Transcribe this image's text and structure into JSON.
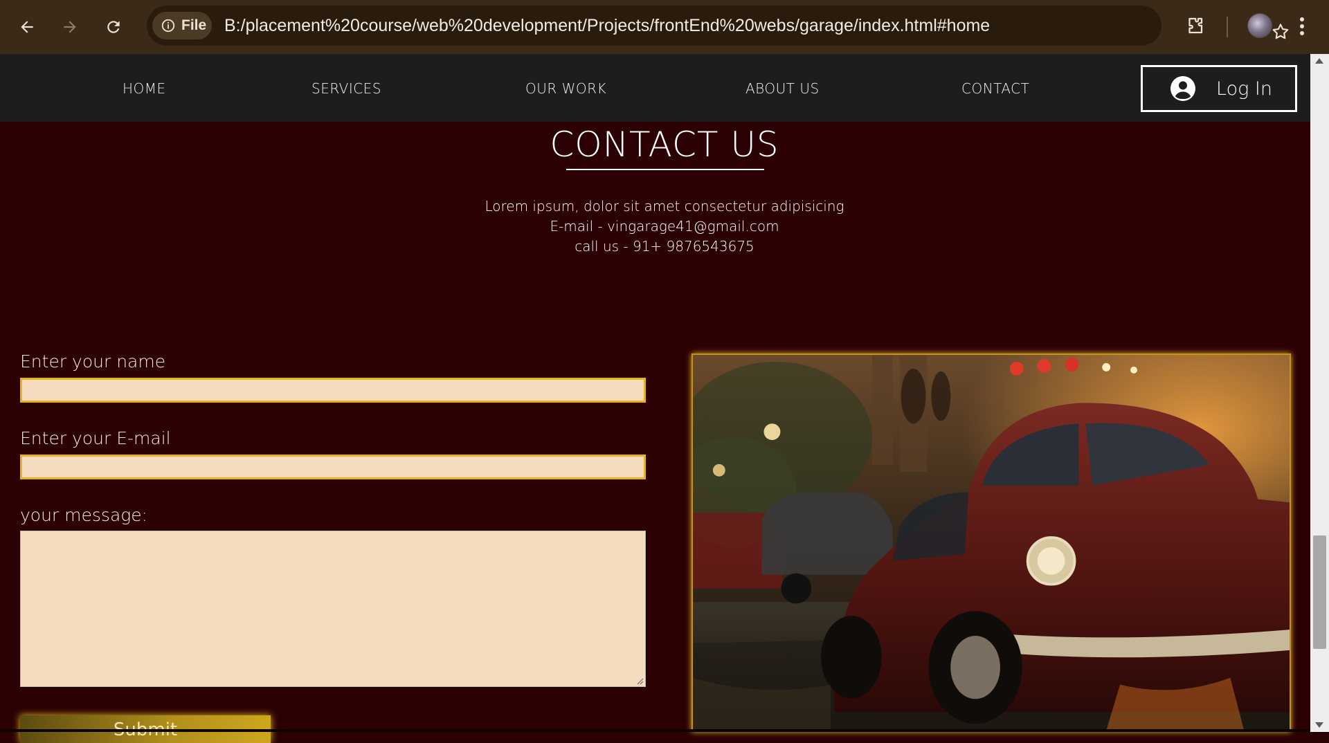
{
  "browser": {
    "file_chip": "File",
    "url": "B:/placement%20course/web%20development/Projects/frontEnd%20webs/garage/index.html#home"
  },
  "nav": {
    "links": [
      "HOME",
      "SERVICES",
      "OUR WORK",
      "ABOUT US",
      "CONTACT"
    ],
    "login_label": "Log In"
  },
  "contact": {
    "title": "CONTACT US",
    "line1": "Lorem ipsum, dolor sit amet consectetur adipisicing",
    "line2": "E-mail - vingarage41@gmail.com",
    "line3": "call us - 91+ 9876543675"
  },
  "form": {
    "name_label": "Enter your name",
    "email_label": "Enter your E-mail",
    "message_label": "your message:",
    "submit_label": "Submit"
  },
  "colors": {
    "page_bg": "#2c0104",
    "nav_bg": "#1d1d1d",
    "input_bg": "#f6dcbf",
    "input_border": "#e6b41e",
    "accent_gold": "#c49418"
  },
  "icons": {
    "back": "arrow-left-icon",
    "forward": "arrow-right-icon",
    "reload": "reload-icon",
    "info": "info-icon",
    "bookmark": "star-icon",
    "extensions": "puzzle-icon",
    "menu": "kebab-menu-icon",
    "account": "account-circle-icon"
  }
}
